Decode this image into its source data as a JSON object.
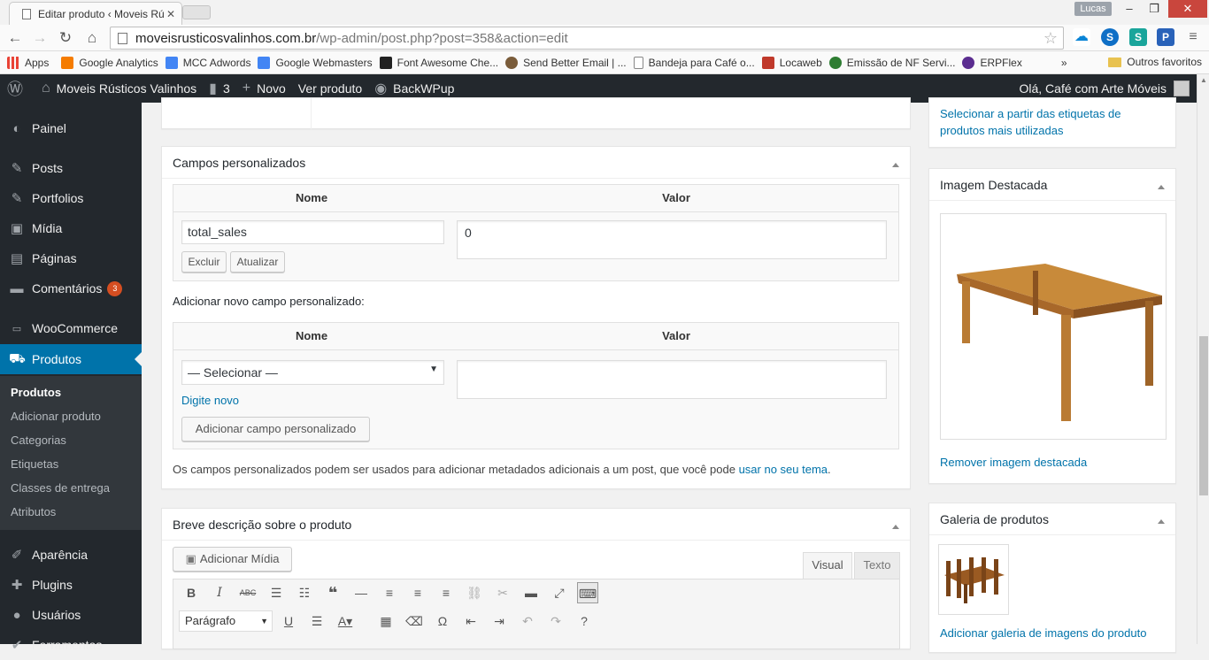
{
  "browser": {
    "tab_title": "Editar produto ‹ Moveis Rú",
    "profile_name": "Lucas",
    "url_domain": "moveisrusticosvalinhos.com.br",
    "url_path": "/wp-admin/post.php?post=358&action=edit",
    "bookmarks": [
      {
        "label": "Apps",
        "color": "#e94235"
      },
      {
        "label": "Google Analytics",
        "color": "#f57c00"
      },
      {
        "label": "MCC Adwords",
        "color": "#4285f4"
      },
      {
        "label": "Google Webmasters",
        "color": "#4285f4"
      },
      {
        "label": "Font Awesome Che...",
        "color": "#222222"
      },
      {
        "label": "Send Better Email | ...",
        "color": "#7a5c3a"
      },
      {
        "label": "Bandeja para Café o...",
        "color": "#ffffff"
      },
      {
        "label": "Locaweb",
        "color": "#c0392b"
      },
      {
        "label": "Emissão de NF Servi...",
        "color": "#2e7d32"
      },
      {
        "label": "ERPFlex",
        "color": "#5b2d90"
      }
    ],
    "bookmarks_more": "»",
    "other_bookmarks": "Outros favoritos"
  },
  "adminbar": {
    "site_name": "Moveis Rústicos Valinhos",
    "comments_count": "3",
    "new_label": "Novo",
    "view_product": "Ver produto",
    "backwpup": "BackWPup",
    "greeting": "Olá, Café com Arte Móveis"
  },
  "sidebar": {
    "items": [
      {
        "label": "Painel",
        "icon": "dashboard-icon"
      },
      {
        "label": "Posts",
        "icon": "pin-icon"
      },
      {
        "label": "Portfolios",
        "icon": "pin-icon"
      },
      {
        "label": "Mídia",
        "icon": "media-icon"
      },
      {
        "label": "Páginas",
        "icon": "pages-icon"
      },
      {
        "label": "Comentários",
        "icon": "comments-icon",
        "badge": "3"
      },
      {
        "label": "WooCommerce",
        "icon": "woo-icon"
      },
      {
        "label": "Produtos",
        "icon": "cart-icon"
      },
      {
        "label": "Aparência",
        "icon": "brush-icon"
      },
      {
        "label": "Plugins",
        "icon": "plugin-icon"
      },
      {
        "label": "Usuários",
        "icon": "users-icon"
      },
      {
        "label": "Ferramentas",
        "icon": "tools-icon"
      }
    ],
    "submenu": [
      "Produtos",
      "Adicionar produto",
      "Categorias",
      "Etiquetas",
      "Classes de entrega",
      "Atributos"
    ]
  },
  "custom_fields": {
    "title": "Campos personalizados",
    "col_name": "Nome",
    "col_value": "Valor",
    "field_name": "total_sales",
    "field_value": "0",
    "delete_btn": "Excluir",
    "update_btn": "Atualizar",
    "add_new_label": "Adicionar novo campo personalizado:",
    "select_default": "— Selecionar —",
    "enter_new": "Digite novo",
    "add_btn": "Adicionar campo personalizado",
    "help_text": "Os campos personalizados podem ser usados para adicionar metadados adicionais a um post, que você pode",
    "help_link": "usar no seu tema",
    "help_end": "."
  },
  "short_desc": {
    "title": "Breve descrição sobre o produto",
    "add_media": "Adicionar Mídia",
    "tab_visual": "Visual",
    "tab_text": "Texto",
    "format_select": "Parágrafo"
  },
  "tags_box": {
    "link": "Selecionar a partir das etiquetas de produtos mais utilizadas"
  },
  "featured_image": {
    "title": "Imagem Destacada",
    "remove_link": "Remover imagem destacada"
  },
  "gallery": {
    "title": "Galeria de produtos",
    "add_link": "Adicionar galeria de imagens do produto"
  }
}
